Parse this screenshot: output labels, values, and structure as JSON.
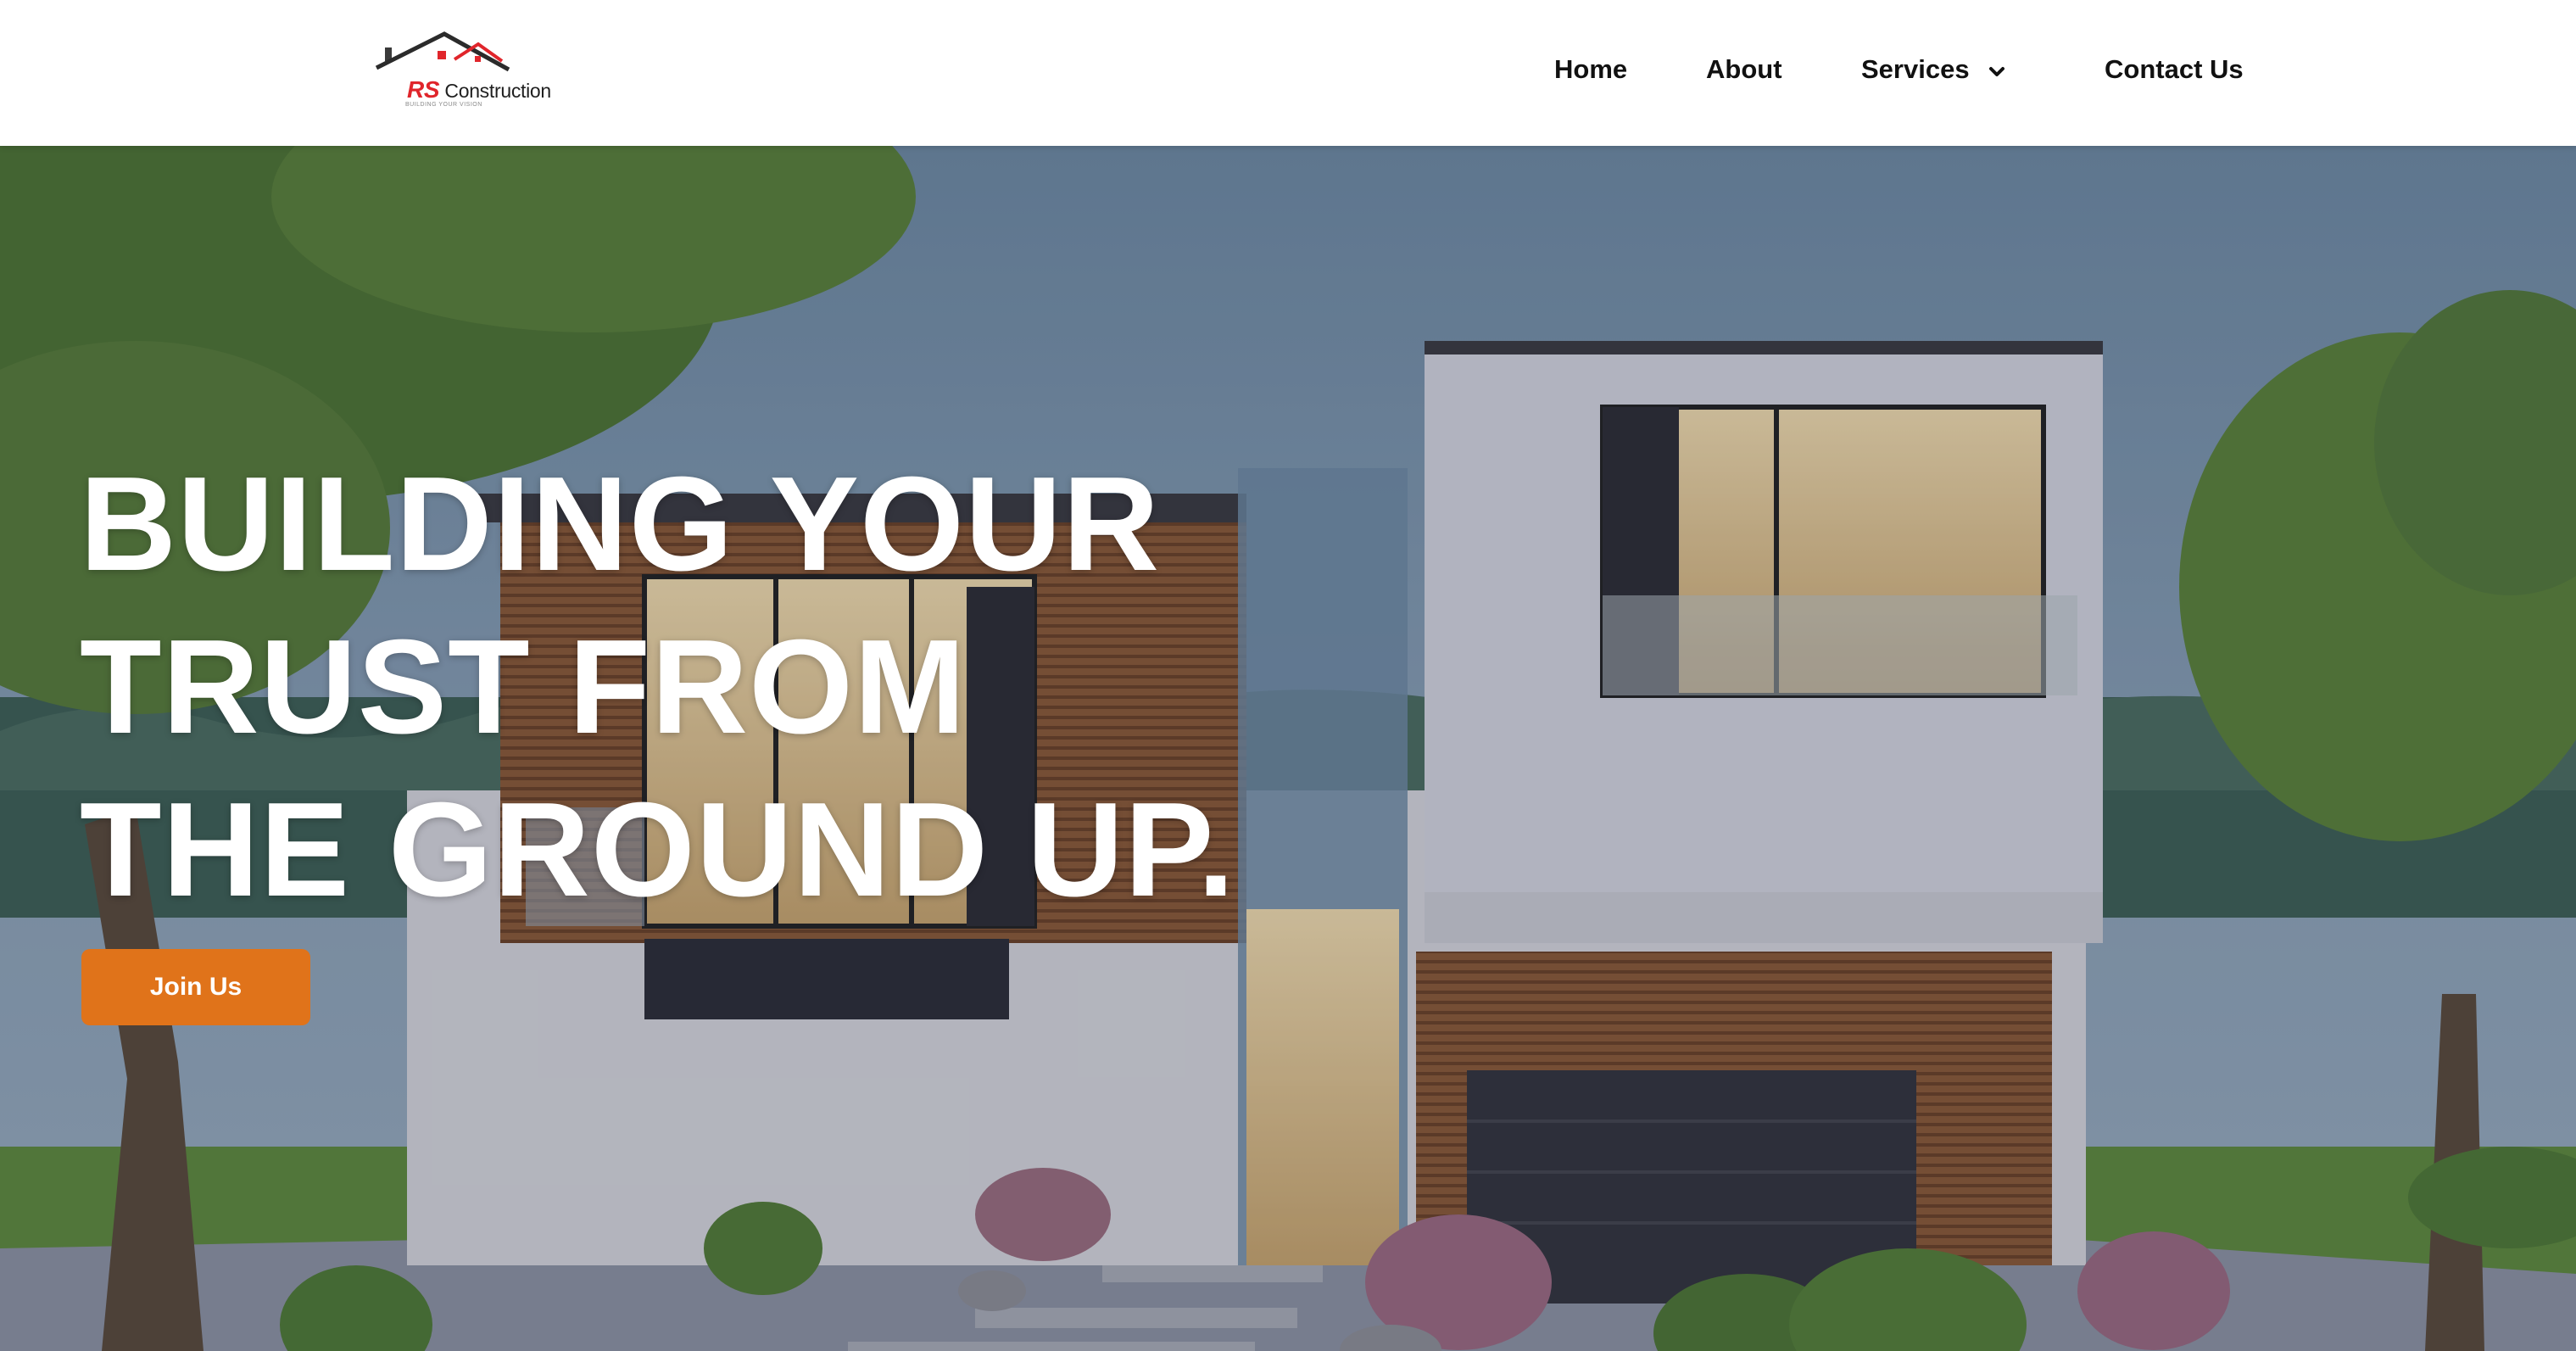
{
  "brand": {
    "logo_initials": "RS",
    "logo_word": "Construction",
    "tagline": "BUILDING YOUR VISION",
    "accent_color": "#e0252b"
  },
  "nav": {
    "items": [
      {
        "label": "Home"
      },
      {
        "label": "About"
      },
      {
        "label": "Services",
        "icon": "chevron-down-icon"
      },
      {
        "label": "Contact Us"
      }
    ]
  },
  "hero": {
    "title_lines": [
      "BUILDING YOUR",
      "TRUST FROM",
      "THE GROUND UP."
    ],
    "cta_label": "Join Us",
    "cta_color": "#e0731a"
  }
}
